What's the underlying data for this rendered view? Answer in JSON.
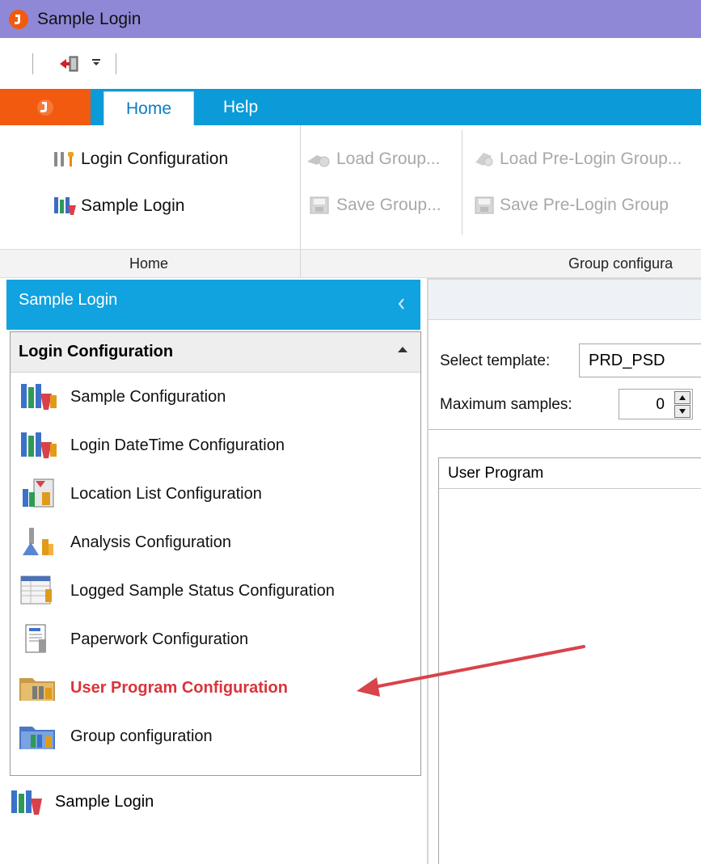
{
  "window": {
    "title": "Sample Login"
  },
  "ribbon": {
    "tabs": [
      {
        "label": "Home"
      },
      {
        "label": "Help"
      }
    ],
    "home_group": {
      "login_configuration": "Login Configuration",
      "sample_login": "Sample Login",
      "label": "Home"
    },
    "group_configuration": {
      "load_group": "Load Group...",
      "save_group": "Save Group...",
      "load_prelogin_group": "Load Pre-Login Group...",
      "save_prelogin_group": "Save Pre-Login Group",
      "label": "Group configura"
    }
  },
  "nav": {
    "header": "Sample Login",
    "group": "Login Configuration",
    "items": [
      {
        "label": "Sample Configuration",
        "icon": "flask-icon"
      },
      {
        "label": "Login DateTime Configuration",
        "icon": "flask-icon"
      },
      {
        "label": "Location List Configuration",
        "icon": "location-list-icon"
      },
      {
        "label": "Analysis Configuration",
        "icon": "analysis-icon"
      },
      {
        "label": "Logged Sample Status Configuration",
        "icon": "status-grid-icon"
      },
      {
        "label": "Paperwork Configuration",
        "icon": "paperwork-icon"
      },
      {
        "label": "User Program Configuration",
        "icon": "user-program-folder-icon",
        "active": true
      },
      {
        "label": "Group configuration",
        "icon": "group-folder-icon"
      }
    ],
    "bottom_item": "Sample Login"
  },
  "content": {
    "select_template_label": "Select template:",
    "template_value": "PRD_PSD",
    "max_samples_label": "Maximum samples:",
    "max_samples_value": "0",
    "grid_header": "User Program"
  },
  "colors": {
    "titlebar": "#8e88d6",
    "ribbon_tab_bar": "#0b9bd8",
    "app_button": "#f25a0f",
    "nav_header": "#11a2e0",
    "active_item_text": "#d9343b",
    "annotation_arrow": "#d9434a"
  }
}
